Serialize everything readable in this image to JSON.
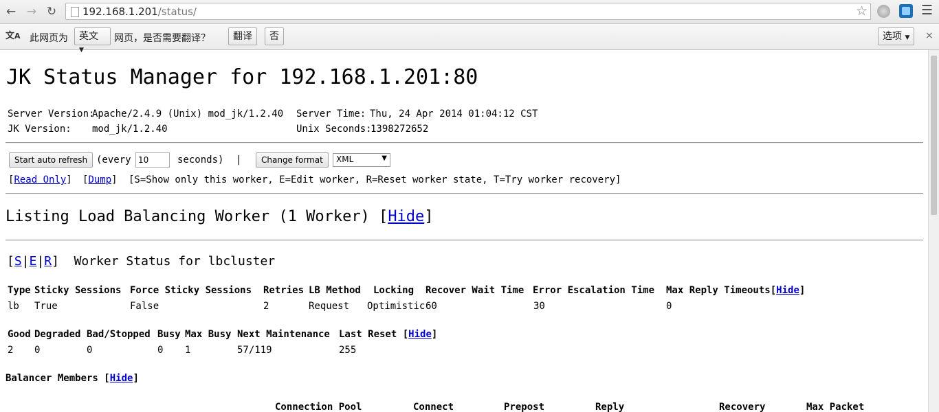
{
  "browser": {
    "url_host": "192.168.1.201",
    "url_path": "/status/"
  },
  "translate_bar": {
    "prefix": "此网页为",
    "language": "英文",
    "suffix": "网页，是否需要翻译？",
    "translate_label": "翻译",
    "no_label": "否",
    "options_label": "选项",
    "close": "×"
  },
  "page": {
    "title": "JK Status Manager for 192.168.1.201:80",
    "server_version_label": "Server Version:",
    "server_version": "Apache/2.4.9 (Unix) mod_jk/1.2.40",
    "server_time_label": "Server Time:",
    "server_time": "Thu, 24 Apr 2014 01:04:12 CST",
    "jk_version_label": "JK Version:",
    "jk_version": "mod_jk/1.2.40",
    "unix_seconds_label": "Unix Seconds:",
    "unix_seconds": "1398272652",
    "auto_refresh_label": "Start auto refresh",
    "every_label": "(every",
    "refresh_value": "10",
    "seconds_label": "seconds)",
    "separator": "|",
    "change_format_label": "Change format",
    "format_value": "XML",
    "read_only_link": "Read Only",
    "dump_link": "Dump",
    "legend": "[S=Show only this worker, E=Edit worker, R=Reset worker state, T=Try worker recovery]",
    "listing_title": "Listing Load Balancing Worker (1 Worker)",
    "hide_link": "Hide",
    "worker_actions": [
      "S",
      "E",
      "R"
    ],
    "worker_status_title": "Worker Status for lbcluster",
    "worker_table": {
      "headers": [
        "Type",
        "Sticky Sessions",
        "Force Sticky Sessions",
        "Retries",
        "LB Method",
        "Locking",
        "Recover Wait Time",
        "Error Escalation Time",
        "Max Reply Timeouts"
      ],
      "row": [
        "lb",
        "True",
        "False",
        "2",
        "Request",
        "Optimistic",
        "60",
        "30",
        "0"
      ]
    },
    "status_table": {
      "headers": [
        "Good",
        "Degraded",
        "Bad/Stopped",
        "Busy",
        "Max Busy",
        "Next Maintenance",
        "Last Reset"
      ],
      "row": [
        "2",
        "0",
        "0",
        "0",
        "1",
        "57/119",
        "255"
      ]
    },
    "balancer_members_title": "Balancer Members",
    "members_headers_partial": [
      "Connection Pool",
      "Connect",
      "Prepost",
      "Reply",
      "Recovery",
      "Max Packet"
    ]
  }
}
